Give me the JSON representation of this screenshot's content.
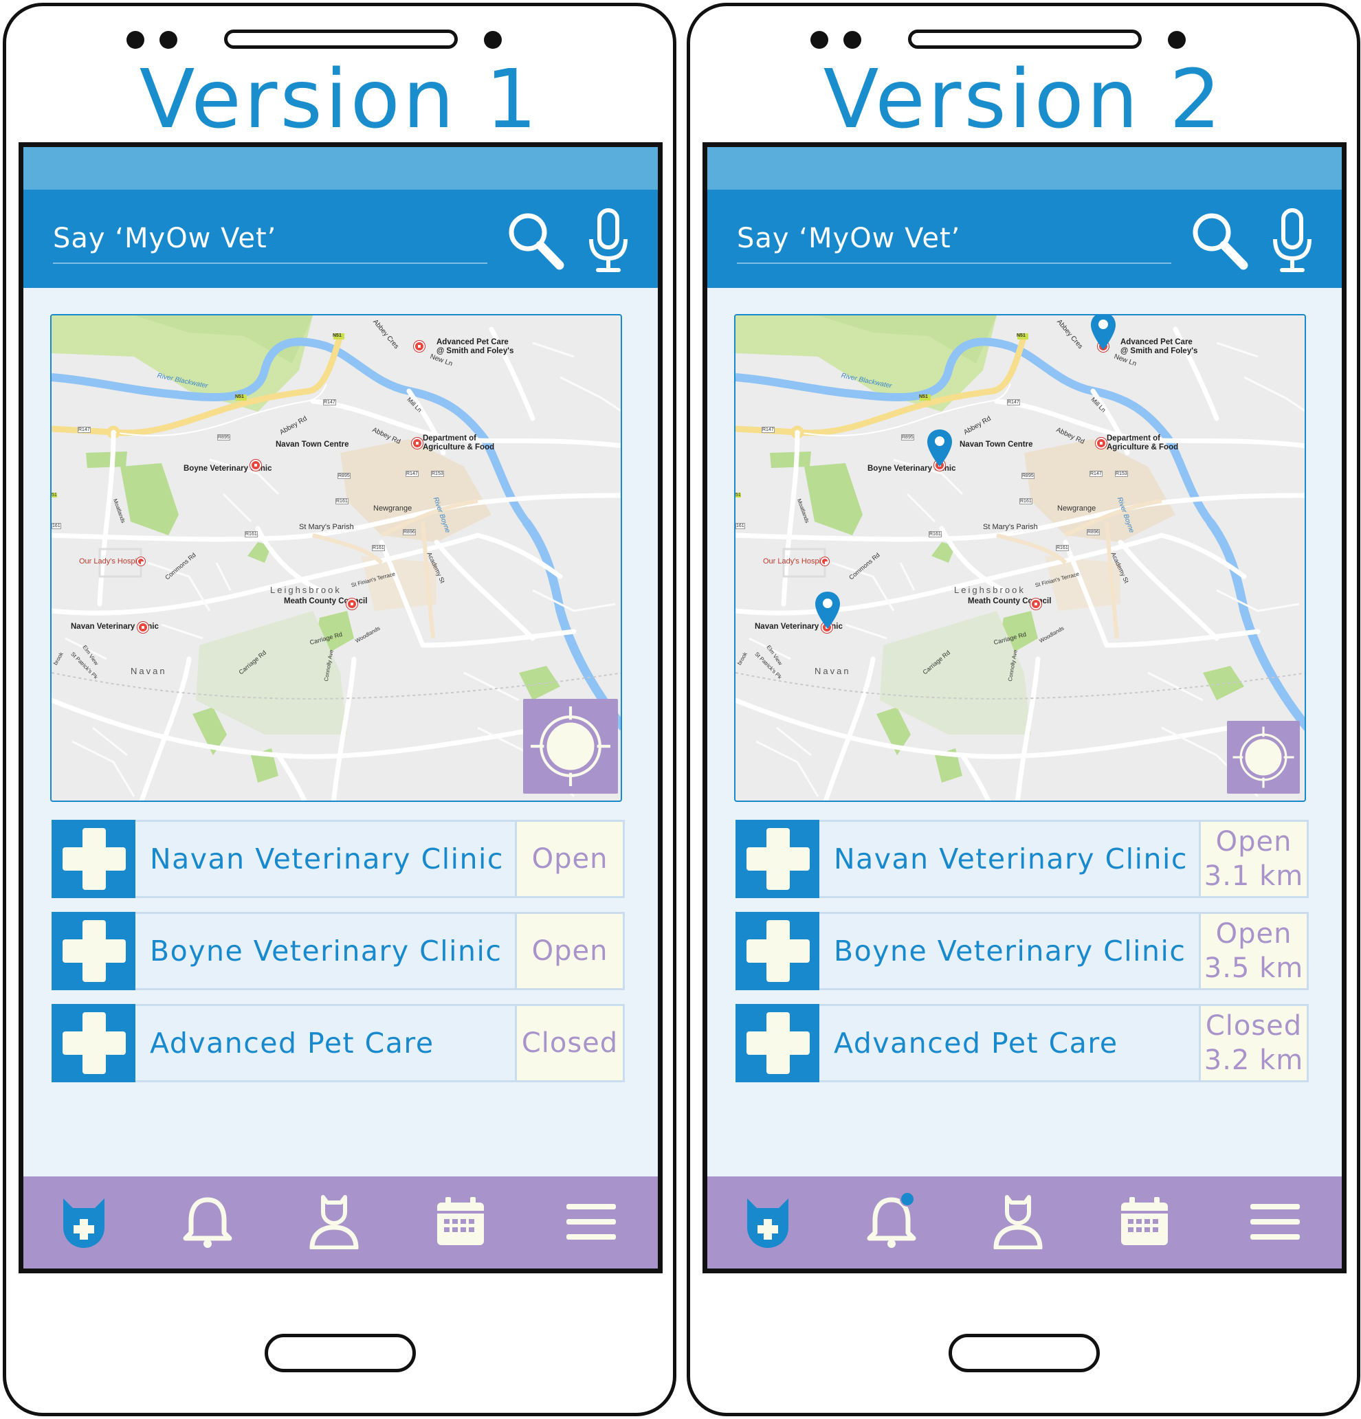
{
  "colors": {
    "accent_blue": "#1789cc",
    "status_bar_blue": "#5aaedc",
    "nav_purple": "#a894ca",
    "screen_bg": "#e9f3f9",
    "status_bg": "#fafaeb"
  },
  "phones": [
    {
      "title": "Version 1",
      "search": {
        "placeholder": "Say ‘MyOw Vet’",
        "search_icon": "search-icon",
        "mic_icon": "microphone-icon"
      },
      "map": {
        "labels": {
          "advanced_pet_care": "Advanced Pet Care",
          "smith_foleys": "@ Smith and Foley's",
          "new_ln": "New Ln",
          "abbey_cres": "Abbey Cres",
          "river_blackwater": "River Blackwater",
          "n51_a": "N51",
          "n51_b": "N51",
          "r147_a": "R147",
          "r147_b": "R147",
          "r147_c": "R147",
          "r153": "R153",
          "r895_a": "R895",
          "r895_b": "R895",
          "r161_a": "R161",
          "r161_b": "R161",
          "r161_c": "R161",
          "r896": "R896",
          "mill_ln": "Mill Ln",
          "abbey_rd_a": "Abbey Rd",
          "abbey_rd_b": "Abbey Rd",
          "navan_town_centre": "Navan Town Centre",
          "dept_agri_1": "Department of",
          "dept_agri_2": "Agriculture & Food",
          "boyne_vet": "Boyne Veterinary Clinic",
          "river_boyne": "River Boyne",
          "newgrange": "Newgrange",
          "st_marys": "St Mary's Parish",
          "our_ladys": "Our Lady's Hospital",
          "commons_rd": "Commons Rd",
          "leighsbrook": "Leighsbrook",
          "meath_cc": "Meath County Council",
          "st_finians": "St Finian's Terrace",
          "academy_st": "Academy St",
          "navan_vet": "Navan Veterinary Clinic",
          "carriage_rd_a": "Carriage Rd",
          "carriage_rd_b": "Carriage Rd",
          "woodlands": "Woodlands",
          "connolly_ave": "Connolly Ave",
          "navan": "Navan",
          "elm_view": "Elm View",
          "st_patricks": "St Patrick's Pk",
          "moatlands": "Moatlands",
          "brook": "brook",
          "n51_side": "51",
          "r161_side": "161"
        },
        "pins": []
      },
      "clinics": [
        {
          "name": "Navan Veterinary Clinic",
          "status": "Open",
          "distance": ""
        },
        {
          "name": "Boyne Veterinary Clinic",
          "status": "Open",
          "distance": ""
        },
        {
          "name": "Advanced Pet Care",
          "status": "Closed",
          "distance": ""
        }
      ],
      "nav": {
        "items": [
          "vet-cat-icon",
          "bell-icon",
          "profile-icon",
          "calendar-icon",
          "menu-icon"
        ],
        "notification": false
      }
    },
    {
      "title": "Version 2",
      "search": {
        "placeholder": "Say ‘MyOw Vet’",
        "search_icon": "search-icon",
        "mic_icon": "microphone-icon"
      },
      "map": {
        "labels": {
          "advanced_pet_care": "Advanced Pet Care",
          "smith_foleys": "@ Smith and Foley's",
          "new_ln": "New Ln",
          "abbey_cres": "Abbey Cres",
          "river_blackwater": "River Blackwater",
          "n51_a": "N51",
          "n51_b": "N51",
          "r147_a": "R147",
          "r147_b": "R147",
          "r147_c": "R147",
          "r153": "R153",
          "r895_a": "R895",
          "r895_b": "R895",
          "r161_a": "R161",
          "r161_b": "R161",
          "r161_c": "R161",
          "r896": "R896",
          "mill_ln": "Mill Ln",
          "abbey_rd_a": "Abbey Rd",
          "abbey_rd_b": "Abbey Rd",
          "navan_town_centre": "Navan Town Centre",
          "dept_agri_1": "Department of",
          "dept_agri_2": "Agriculture & Food",
          "boyne_vet": "Boyne Veterinary Clinic",
          "river_boyne": "River Boyne",
          "newgrange": "Newgrange",
          "st_marys": "St Mary's Parish",
          "our_ladys": "Our Lady's Hospital",
          "commons_rd": "Commons Rd",
          "leighsbrook": "Leighsbrook",
          "meath_cc": "Meath County Council",
          "st_finians": "St Finian's Terrace",
          "academy_st": "Academy St",
          "navan_vet": "Navan Veterinary Clinic",
          "carriage_rd_a": "Carriage Rd",
          "carriage_rd_b": "Carriage Rd",
          "woodlands": "Woodlands",
          "connolly_ave": "Connolly Ave",
          "navan": "Navan",
          "elm_view": "Elm View",
          "st_patricks": "St Patrick's Pk",
          "moatlands": "Moatlands",
          "brook": "brook",
          "n51_side": "51",
          "r161_side": "161"
        },
        "pins": [
          "advanced-pet-care",
          "boyne-veterinary-clinic",
          "navan-veterinary-clinic"
        ]
      },
      "clinics": [
        {
          "name": "Navan Veterinary Clinic",
          "status": "Open",
          "distance": "3.1 km"
        },
        {
          "name": "Boyne Veterinary Clinic",
          "status": "Open",
          "distance": "3.5 km"
        },
        {
          "name": "Advanced Pet Care",
          "status": "Closed",
          "distance": "3.2 km"
        }
      ],
      "nav": {
        "items": [
          "vet-cat-icon",
          "bell-icon",
          "profile-icon",
          "calendar-icon",
          "menu-icon"
        ],
        "notification": true
      }
    }
  ]
}
